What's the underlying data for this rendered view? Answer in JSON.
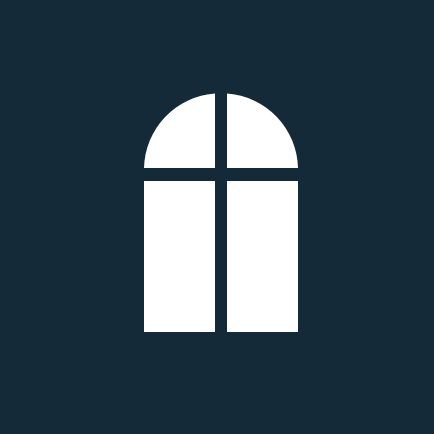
{
  "icon": {
    "name": "arched-window-icon",
    "colors": {
      "background": "#142a38",
      "foreground": "#ffffff"
    }
  }
}
